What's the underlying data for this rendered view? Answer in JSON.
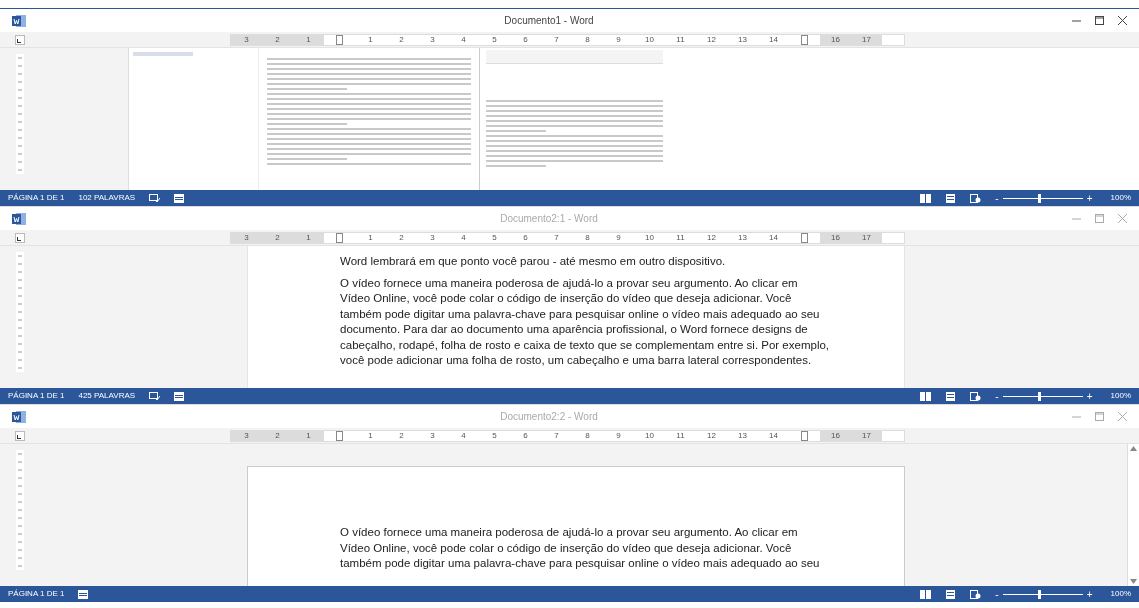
{
  "windows": [
    {
      "title": "Documento1 - Word",
      "active": true,
      "ruler": [
        {
          "kind": "number",
          "label": "3"
        },
        {
          "kind": "number",
          "label": "2"
        },
        {
          "kind": "number",
          "label": "1"
        },
        {
          "kind": "marker"
        },
        {
          "kind": "number",
          "label": "1"
        },
        {
          "kind": "number",
          "label": "2"
        },
        {
          "kind": "number",
          "label": "3"
        },
        {
          "kind": "number",
          "label": "4"
        },
        {
          "kind": "number",
          "label": "5"
        },
        {
          "kind": "number",
          "label": "6"
        },
        {
          "kind": "number",
          "label": "7"
        },
        {
          "kind": "number",
          "label": "8"
        },
        {
          "kind": "number",
          "label": "9"
        },
        {
          "kind": "number",
          "label": "10"
        },
        {
          "kind": "number",
          "label": "11"
        },
        {
          "kind": "number",
          "label": "12"
        },
        {
          "kind": "number",
          "label": "13"
        },
        {
          "kind": "number",
          "label": "14"
        },
        {
          "kind": "marker"
        },
        {
          "kind": "number",
          "label": "16"
        },
        {
          "kind": "number",
          "label": "17"
        }
      ],
      "body": {
        "kind": "image"
      },
      "status": {
        "page": "PÁGINA 1 DE 1",
        "words": "102 PALAVRAS",
        "proofing": true,
        "zoom_out": "-",
        "zoom_in": "+",
        "zoom": "100%",
        "level": 0.45
      },
      "scrollbar": false
    },
    {
      "title": "Documento2:1 - Word",
      "active": false,
      "ruler": [
        {
          "kind": "number",
          "label": "3"
        },
        {
          "kind": "number",
          "label": "2"
        },
        {
          "kind": "number",
          "label": "1"
        },
        {
          "kind": "marker"
        },
        {
          "kind": "number",
          "label": "1"
        },
        {
          "kind": "number",
          "label": "2"
        },
        {
          "kind": "number",
          "label": "3"
        },
        {
          "kind": "number",
          "label": "4"
        },
        {
          "kind": "number",
          "label": "5"
        },
        {
          "kind": "number",
          "label": "6"
        },
        {
          "kind": "number",
          "label": "7"
        },
        {
          "kind": "number",
          "label": "8"
        },
        {
          "kind": "number",
          "label": "9"
        },
        {
          "kind": "number",
          "label": "10"
        },
        {
          "kind": "number",
          "label": "11"
        },
        {
          "kind": "number",
          "label": "12"
        },
        {
          "kind": "number",
          "label": "13"
        },
        {
          "kind": "number",
          "label": "14"
        },
        {
          "kind": "marker"
        },
        {
          "kind": "number",
          "label": "16"
        },
        {
          "kind": "number",
          "label": "17"
        }
      ],
      "body": {
        "kind": "text",
        "page_top": false,
        "paragraphs": [
          "Word lembrará em que ponto você parou - até mesmo em outro dispositivo.",
          "O vídeo fornece uma maneira poderosa de ajudá-lo a provar seu argumento. Ao clicar em Vídeo Online, você pode colar o código de inserção do vídeo que deseja adicionar. Você também pode digitar uma palavra-chave para pesquisar online o vídeo mais adequado ao seu documento. Para dar ao documento uma aparência profissional, o Word fornece designs de cabeçalho, rodapé, folha de rosto e caixa de texto que se complementam entre si. Por exemplo, você pode adicionar uma folha de rosto, um cabeçalho e uma barra lateral correspondentes."
        ]
      },
      "status": {
        "page": "PÁGINA 1 DE 1",
        "words": "425 PALAVRAS",
        "proofing": true,
        "zoom_out": "-",
        "zoom_in": "+",
        "zoom": "100%",
        "level": 0.45
      },
      "scrollbar": false
    },
    {
      "title": "Documento2:2 - Word",
      "active": false,
      "ruler": [
        {
          "kind": "number",
          "label": "3"
        },
        {
          "kind": "number",
          "label": "2"
        },
        {
          "kind": "number",
          "label": "1"
        },
        {
          "kind": "marker"
        },
        {
          "kind": "number",
          "label": "1"
        },
        {
          "kind": "number",
          "label": "2"
        },
        {
          "kind": "number",
          "label": "3"
        },
        {
          "kind": "number",
          "label": "4"
        },
        {
          "kind": "number",
          "label": "5"
        },
        {
          "kind": "number",
          "label": "6"
        },
        {
          "kind": "number",
          "label": "7"
        },
        {
          "kind": "number",
          "label": "8"
        },
        {
          "kind": "number",
          "label": "9"
        },
        {
          "kind": "number",
          "label": "10"
        },
        {
          "kind": "number",
          "label": "11"
        },
        {
          "kind": "number",
          "label": "12"
        },
        {
          "kind": "number",
          "label": "13"
        },
        {
          "kind": "number",
          "label": "14"
        },
        {
          "kind": "marker"
        },
        {
          "kind": "number",
          "label": "16"
        },
        {
          "kind": "number",
          "label": "17"
        }
      ],
      "body": {
        "kind": "text",
        "page_top": true,
        "paragraphs": [
          "O vídeo fornece uma maneira poderosa de ajudá-lo a provar seu argumento. Ao clicar em Vídeo Online, você pode colar o código de inserção do vídeo que deseja adicionar. Você também pode digitar uma palavra-chave para pesquisar online o vídeo mais adequado ao seu"
        ]
      },
      "status": {
        "page": "PÁGINA 1 DE 1",
        "proofing": false,
        "zoom_out": "-",
        "zoom_in": "+",
        "zoom": "100%",
        "level": 0.45
      },
      "scrollbar": true
    }
  ]
}
